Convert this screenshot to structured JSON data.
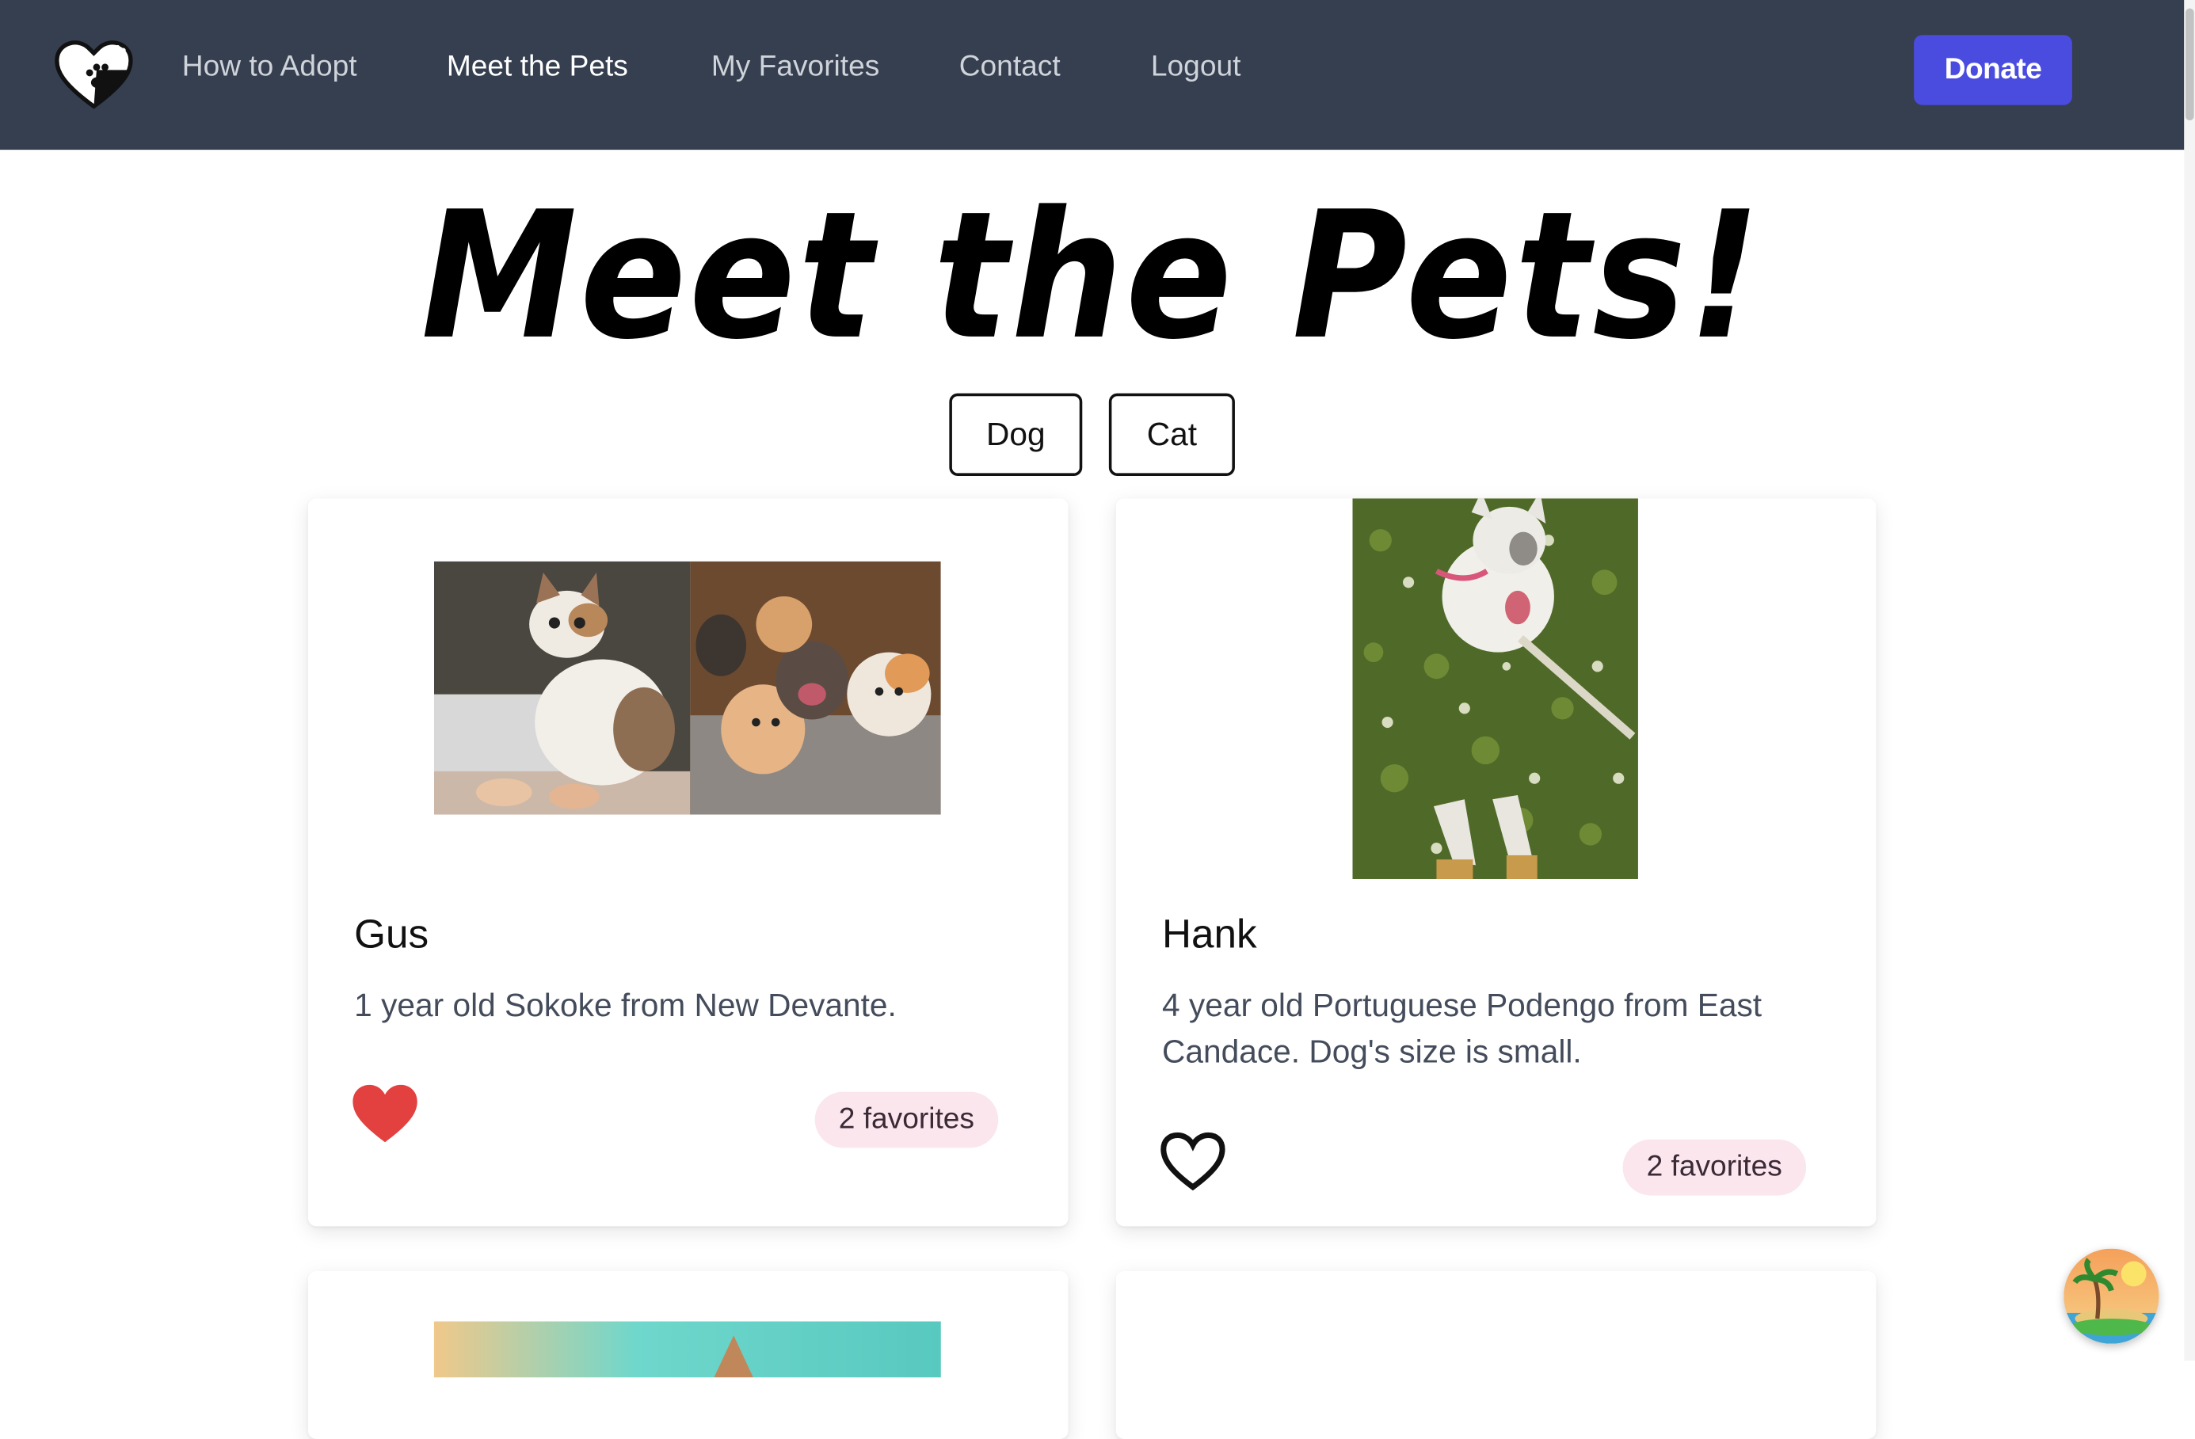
{
  "nav": {
    "logo_icon": "heart-paw-icon",
    "links": [
      "How to Adopt",
      "Meet the Pets",
      "My Favorites",
      "Contact",
      "Logout"
    ],
    "active": "Meet the Pets",
    "donate_label": "Donate"
  },
  "colors": {
    "navbar_bg": "#363f50",
    "donate_bg": "#4a4ce0",
    "favorited_heart": "#e34040",
    "badge_bg": "#fbe6ee"
  },
  "page": {
    "title": "Meet the Pets!"
  },
  "filters": [
    "Dog",
    "Cat"
  ],
  "pets": [
    {
      "name": "Gus",
      "description": "1 year old Sokoke from New Devante.",
      "favorited": true,
      "favorites_label": "2 favorites",
      "photo": "kittens-collage"
    },
    {
      "name": "Hank",
      "description": "4 year old Portuguese Podengo from East Candace. Dog's size is small.",
      "favorited": false,
      "favorites_label": "2 favorites",
      "photo": "dog-on-grass"
    }
  ]
}
